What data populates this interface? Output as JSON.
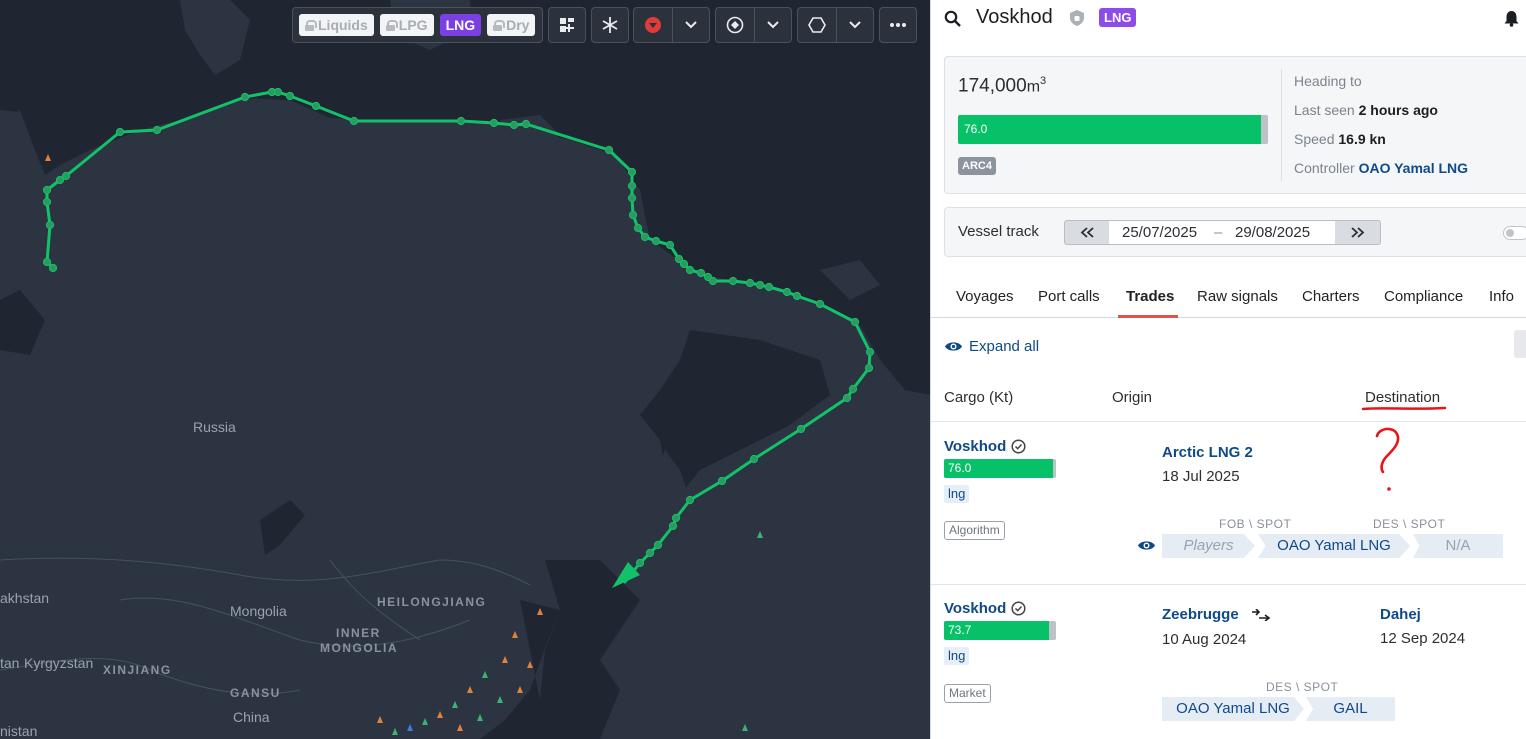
{
  "toolbar": {
    "chips": [
      {
        "label": "Liquids",
        "locked": true,
        "active": false
      },
      {
        "label": "LPG",
        "locked": true,
        "active": false
      },
      {
        "label": "LNG",
        "locked": false,
        "active": true
      },
      {
        "label": "Dry",
        "locked": true,
        "active": false
      }
    ],
    "icons": [
      "layers-icon",
      "snowflake-icon",
      "marker-icon",
      "chevron-down-icon",
      "target-icon",
      "chevron-down-icon",
      "hexagon-icon",
      "chevron-down-icon",
      "more-icon"
    ]
  },
  "map": {
    "labels": {
      "russia": "Russia",
      "kazakhstan": "akhstan",
      "mongolia": "Mongolia",
      "heilongjiang": "HEILONGJIANG",
      "inner_mongolia_1": "INNER",
      "inner_mongolia_2": "MONGOLIA",
      "xinjiang": "XINJIANG",
      "kyrgyzstan": "Kyrgyzstan",
      "stan": "tan",
      "gansu": "GANSU",
      "china": "China",
      "nistan": "nistan"
    },
    "track_color": "#12c26b"
  },
  "vessel": {
    "name": "Voskhod",
    "type_badge": "LNG",
    "capacity": "174,000",
    "capacity_unit": "m",
    "capacity_sup": "3",
    "fill_label": "76.0",
    "fill_fraction": 0.976,
    "ice_class": "ARC4",
    "heading_label": "Heading to",
    "last_seen_label": "Last seen",
    "last_seen_value": "2 hours ago",
    "speed_label": "Speed",
    "speed_value": "16.9 kn",
    "controller_label": "Controller",
    "controller_value": "OAO Yamal LNG"
  },
  "track": {
    "label": "Vessel track",
    "from": "25/07/2025",
    "separator": "–",
    "to": "29/08/2025"
  },
  "tabs": [
    "Voyages",
    "Port calls",
    "Trades",
    "Raw signals",
    "Charters",
    "Compliance",
    "Info"
  ],
  "active_tab": 2,
  "trades": {
    "expand_all": "Expand all",
    "columns": {
      "cargo": "Cargo (Kt)",
      "origin": "Origin",
      "destination": "Destination"
    },
    "rows": [
      {
        "vessel": "Voskhod",
        "fill_label": "76.0",
        "fill_fraction": 0.976,
        "product": "lng",
        "source_tag": "Algorithm",
        "origin": "Arctic LNG 2",
        "origin_date": "18 Jul 2025",
        "destination": "",
        "destination_date": "",
        "annotation": "?",
        "left_terms": "FOB \\ SPOT",
        "right_terms": "DES \\ SPOT",
        "parties": [
          "Players",
          "OAO Yamal LNG",
          "N/A"
        ]
      },
      {
        "vessel": "Voskhod",
        "fill_label": "73.7",
        "fill_fraction": 0.94,
        "product": "lng",
        "source_tag": "Market",
        "origin": "Zeebrugge",
        "origin_date": "10 Aug 2024",
        "destination": "Dahej",
        "destination_date": "12 Sep 2024",
        "terms": "DES \\ SPOT",
        "parties": [
          "OAO Yamal LNG",
          "GAIL"
        ]
      }
    ]
  },
  "colors": {
    "accent": "#0e4a8a",
    "green": "#06c167",
    "purple": "#8d4bea",
    "tab_underline": "#e0514b",
    "annotation": "#e8141a"
  }
}
